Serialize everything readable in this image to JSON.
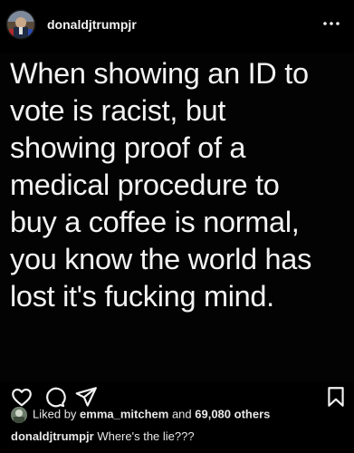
{
  "header": {
    "username": "donaldjtrumpjr",
    "more_icon": "more-horizontal-icon"
  },
  "post": {
    "lines": [
      "When showing an ID to",
      "vote is racist, but",
      "showing proof of a",
      "medical procedure to",
      "buy a coffee is normal,",
      "you know the world has",
      "lost it's fucking mind."
    ]
  },
  "actions": {
    "like_icon": "heart-icon",
    "comment_icon": "comment-icon",
    "share_icon": "send-icon",
    "save_icon": "bookmark-icon"
  },
  "likes": {
    "prefix": "Liked by ",
    "user": "emma_mitchem",
    "middle": " and ",
    "count": "69,080 others"
  },
  "caption": {
    "username": "donaldjtrumpjr",
    "text": " Where's the lie???"
  }
}
